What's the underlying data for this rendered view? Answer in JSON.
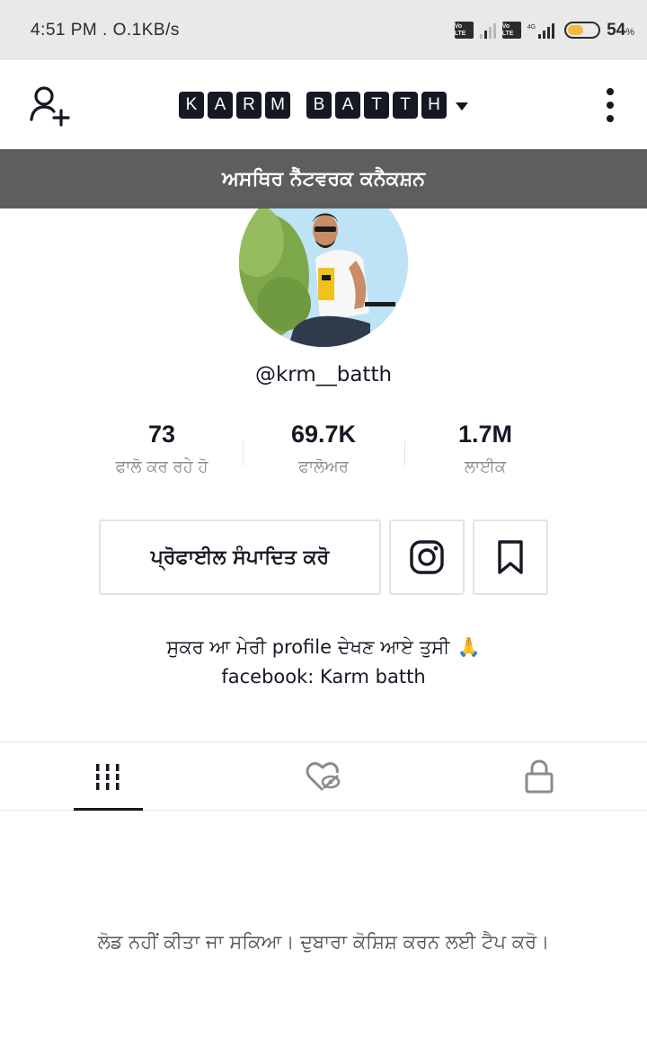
{
  "status_bar": {
    "time_speed": "4:51 PM . O.1KB/s",
    "sim1_label": "Vo LTE",
    "sim2_label": "Vo LTE",
    "network_type": "4G",
    "battery_percent": "54",
    "battery_unit": "%",
    "battery_level": 0.54,
    "battery_color": "#f6b93b"
  },
  "header": {
    "title_letters": [
      "K",
      "A",
      "R",
      "M",
      " ",
      "B",
      "A",
      "T",
      "T",
      "H"
    ],
    "add_user_icon": "person-add-icon",
    "more_icon": "vertical-dots-icon"
  },
  "network_banner": {
    "text": "ਅਸਥਿਰ ਨੈੱਟਵਰਕ ਕਨੈਕਸ਼ਨ"
  },
  "profile": {
    "username": "@krm__batth",
    "stats": [
      {
        "value": "73",
        "label": "ਫਾਲੋ ਕਰ ਰਹੇ ਹੋ"
      },
      {
        "value": "69.7K",
        "label": "ਫਾਲੋਅਰ"
      },
      {
        "value": "1.7M",
        "label": "ਲਾਈਕ"
      }
    ],
    "edit_button_label": "ਪ੍ਰੋਫਾਈਲ ਸੰਪਾਦਿਤ ਕਰੋ",
    "instagram_icon": "instagram-icon",
    "bookmark_icon": "bookmark-icon",
    "bio_line1": "ਸੁਕਰ ਆ ਮੇਰੀ profile ਦੇਖਣ ਆਏ ਤੁਸੀ",
    "bio_emoji": "🙏",
    "bio_line2": "facebook: Karm batth"
  },
  "tabs": [
    {
      "icon": "grid-icon",
      "active": true
    },
    {
      "icon": "liked-hidden-icon",
      "active": false
    },
    {
      "icon": "lock-icon",
      "active": false
    }
  ],
  "content": {
    "load_error": "ਲੋਡ ਨਹੀਂ ਕੀਤਾ ਜਾ ਸਕਿਆ। ਦੁਬਾਰਾ ਕੋਸ਼ਿਸ਼ ਕਰਨ ਲਈ ਟੈਪ ਕਰੋ।"
  },
  "colors": {
    "text_primary": "#161823",
    "text_secondary": "#8a8b91",
    "banner_bg": "#5e5e5e",
    "border": "#e3e3e4"
  }
}
